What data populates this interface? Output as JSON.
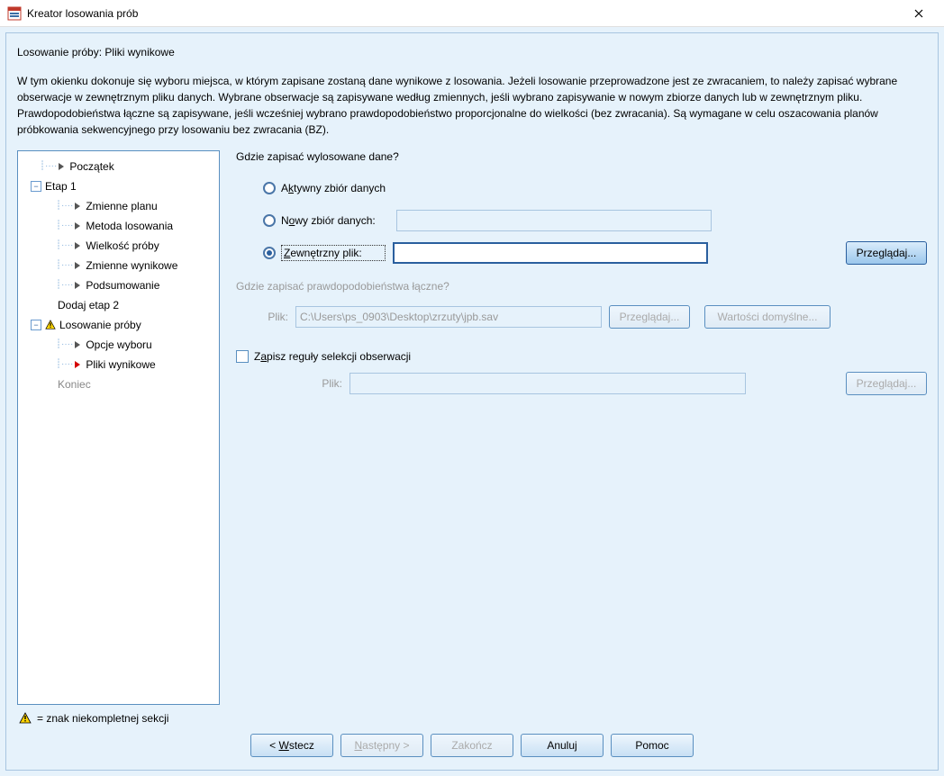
{
  "title": "Kreator losowania prób",
  "heading": "Losowanie próby: Pliki wynikowe",
  "description": "W tym okienku dokonuje się wyboru miejsca, w którym zapisane zostaną dane wynikowe z losowania. Jeżeli losowanie przeprowadzone jest ze zwracaniem, to należy zapisać wybrane obserwacje w zewnętrznym pliku danych. Wybrane obserwacje są zapisywane według zmiennych, jeśli wybrano zapisywanie w nowym zbiorze danych lub w zewnętrznym pliku.\nPrawdopodobieństwa łączne są zapisywane, jeśli wcześniej wybrano prawdopodobieństwo proporcjonalne do wielkości (bez zwracania). Są wymagane w celu oszacowania planów próbkowania sekwencyjnego przy losowaniu bez zwracania (BZ).",
  "tree": {
    "items": [
      {
        "label": "Początek",
        "indent": 38,
        "arrow": true
      },
      {
        "label": "Etap 1",
        "indent": 10,
        "toggle": "-"
      },
      {
        "label": "Zmienne planu",
        "indent": 56,
        "arrow": true
      },
      {
        "label": "Metoda losowania",
        "indent": 56,
        "arrow": true
      },
      {
        "label": "Wielkość próby",
        "indent": 56,
        "arrow": true
      },
      {
        "label": "Zmienne wynikowe",
        "indent": 56,
        "arrow": true
      },
      {
        "label": "Podsumowanie",
        "indent": 56,
        "arrow": true
      },
      {
        "label": "Dodaj etap 2",
        "indent": 40
      },
      {
        "label": "Losowanie próby",
        "indent": 10,
        "toggle": "-",
        "warn": true
      },
      {
        "label": "Opcje wyboru",
        "indent": 56,
        "arrow": true
      },
      {
        "label": "Pliki wynikowe",
        "indent": 56,
        "arrow": true,
        "red": true
      },
      {
        "label": "Koniec",
        "indent": 40,
        "muted": true
      }
    ]
  },
  "legend": "= znak niekompletnej sekcji",
  "right": {
    "q1": "Gdzie zapisać wylosowane dane?",
    "r1_pre": "A",
    "r1_ul": "k",
    "r1_post": "tywny zbiór danych",
    "r2_pre": "N",
    "r2_ul": "o",
    "r2_post": "wy zbiór danych:",
    "r3_pre": "",
    "r3_ul": "Z",
    "r3_post": "ewnętrzny plik:",
    "r2_value": "",
    "r3_value": "",
    "browse": "Przeglądaj...",
    "q2": "Gdzie zapisać prawdopodobieństwa łączne?",
    "file_lbl": "Plik:",
    "file_value": "C:\\Users\\ps_0903\\Desktop\\zrzuty\\jpb.sav",
    "defaults": "Wartości domyślne...",
    "chk_pre": "Z",
    "chk_ul": "a",
    "chk_post": "pisz reguły selekcji obserwacji",
    "file2_lbl": "Plik:",
    "file2_value": ""
  },
  "buttons": {
    "back_pre": "<  ",
    "back_ul": "W",
    "back_post": "stecz",
    "next_pre": "",
    "next_ul": "N",
    "next_post": "astępny >",
    "finish": "Zakończ",
    "cancel": "Anuluj",
    "help": "Pomoc"
  }
}
